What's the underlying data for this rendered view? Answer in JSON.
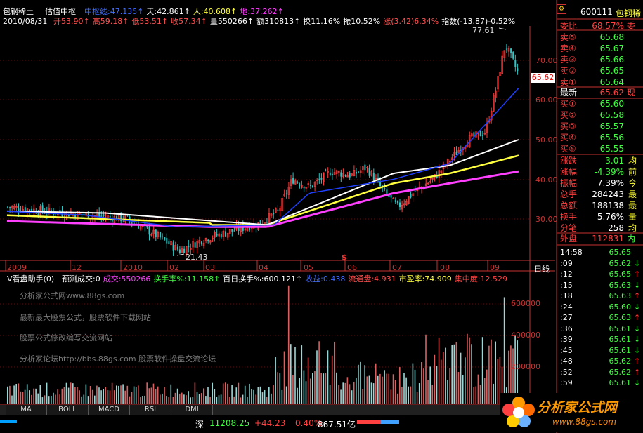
{
  "header": {
    "stock_name": "包钢稀土",
    "indicator": "估值中枢",
    "line1": [
      {
        "text": "中枢线:47.135↑",
        "color": "#3c6cff"
      },
      {
        "text": "天:42.861↑",
        "color": "#ffffff"
      },
      {
        "text": "人:40.608↑",
        "color": "#ffff40"
      },
      {
        "text": "地:37.262↑",
        "color": "#ff40ff"
      }
    ],
    "date": "2010/08/31",
    "line2": [
      {
        "text": "开53.90↑",
        "color": "#ff5050"
      },
      {
        "text": "高59.18↑",
        "color": "#ff5050"
      },
      {
        "text": "低53.51↑",
        "color": "#ff5050"
      },
      {
        "text": "收57.34↑",
        "color": "#ff5050"
      },
      {
        "text": "量550266↑",
        "color": "#ffffff"
      },
      {
        "text": "额310813↑",
        "color": "#ffffff"
      },
      {
        "text": "换11.16%",
        "color": "#ffffff"
      },
      {
        "text": "振10.52%",
        "color": "#ffffff"
      },
      {
        "text": "涨(3.42)6.34%",
        "color": "#ff5050"
      },
      {
        "text": "指数(-13.87)-0.52%",
        "color": "#ffffff"
      }
    ]
  },
  "price_axis": [
    "70.00",
    "60.00",
    "50.00",
    "40.00",
    "30.00"
  ],
  "current_price_tag": "65.62",
  "high_label": "77.61",
  "low_label": "21.43",
  "month_axis": [
    "2009",
    "12",
    "2010",
    "02",
    "03",
    "04",
    "05",
    "06",
    "07",
    "08",
    "09"
  ],
  "period_label": "日线",
  "event_marker": "$",
  "volume_panel": {
    "title": "V看盘助手(0)",
    "items": [
      {
        "text": "预测成交:0",
        "color": "#ffffff"
      },
      {
        "text": "成交:550266",
        "color": "#ff40ff"
      },
      {
        "text": "换手率%:11.158↑",
        "color": "#40ff40"
      },
      {
        "text": "百日换手%:600.121↑",
        "color": "#ffffff"
      },
      {
        "text": "收益:0.438",
        "color": "#3c6cff"
      },
      {
        "text": "流通盘:4.931",
        "color": "#ff5050"
      },
      {
        "text": "市盈率:74.909",
        "color": "#ffff40"
      },
      {
        "text": "集中度:12.529",
        "color": "#ff4040"
      }
    ],
    "axis": [
      "600000",
      "400000",
      "200000"
    ],
    "watermarks": [
      "分析家公式网www.88gs.com",
      "最新最大股票公式，股票软件下载网站",
      "股票公式修改编写交流网站",
      "分析家论坛http://bbs.88gs.com 股票软件操盘交流论坛"
    ]
  },
  "tabs": [
    "MA",
    "BOLL",
    "MACD",
    "RSI",
    "DMI"
  ],
  "status_bar": {
    "market": "深",
    "index": "11208.25",
    "change": "+44.23",
    "pct": "0.40%",
    "amount": "867.51亿"
  },
  "quote_panel": {
    "code": "600111",
    "name": "包钢稀",
    "weibi_label": "委比",
    "weibi_value": "68.57%",
    "weibi_extra": "委",
    "asks": [
      {
        "label": "卖⑤",
        "price": "65.68"
      },
      {
        "label": "卖④",
        "price": "65.67"
      },
      {
        "label": "卖③",
        "price": "65.66"
      },
      {
        "label": "卖②",
        "price": "65.65"
      },
      {
        "label": "卖①",
        "price": "65.64"
      }
    ],
    "last_label": "最新",
    "last_value": "65.62",
    "last_extra": "现",
    "bids": [
      {
        "label": "买①",
        "price": "65.60"
      },
      {
        "label": "买②",
        "price": "65.58"
      },
      {
        "label": "买③",
        "price": "65.57"
      },
      {
        "label": "买④",
        "price": "65.56"
      },
      {
        "label": "买⑤",
        "price": "65.55"
      }
    ],
    "stats": [
      {
        "label": "涨跌",
        "value": "-3.01",
        "extra": "均",
        "color": "#40ff40"
      },
      {
        "label": "涨幅",
        "value": "-4.39%",
        "extra": "前",
        "color": "#40ff40"
      },
      {
        "label": "振幅",
        "value": "7.39%",
        "extra": "今",
        "color": "#ffffff"
      },
      {
        "label": "总手",
        "value": "284243",
        "extra": "最",
        "color": "#ffffff"
      },
      {
        "label": "总额",
        "value": "188138",
        "extra": "最",
        "color": "#ffffff"
      },
      {
        "label": "换手",
        "value": "5.76%",
        "extra": "量",
        "color": "#ffffff"
      },
      {
        "label": "分笔",
        "value": "258",
        "extra": "均",
        "color": "#ffffff"
      }
    ],
    "outer_label": "外盘",
    "outer_value": "112831",
    "outer_extra": "内",
    "trades": [
      {
        "time": "14:58",
        "price": "65.65",
        "dir": ""
      },
      {
        "time": ":09",
        "price": "65.62",
        "dir": "↓"
      },
      {
        "time": ":12",
        "price": "65.65",
        "dir": "↑"
      },
      {
        "time": ":15",
        "price": "65.63",
        "dir": "↓"
      },
      {
        "time": ":18",
        "price": "65.63",
        "dir": "↑"
      },
      {
        "time": ":24",
        "price": "65.60",
        "dir": "↓"
      },
      {
        "time": ":27",
        "price": "65.63",
        "dir": "↑"
      },
      {
        "time": ":36",
        "price": "65.61",
        "dir": "↓"
      },
      {
        "time": ":39",
        "price": "65.61",
        "dir": "↓"
      },
      {
        "time": ":45",
        "price": "65.61",
        "dir": "↓"
      },
      {
        "time": ":48",
        "price": "65.62",
        "dir": "↑"
      },
      {
        "time": ":52",
        "price": "65.62",
        "dir": "↑"
      },
      {
        "time": ":59",
        "price": "65.61",
        "dir": "↓"
      }
    ]
  },
  "logo": {
    "title": "分析家公式网",
    "url": "www.88gs.com"
  }
}
